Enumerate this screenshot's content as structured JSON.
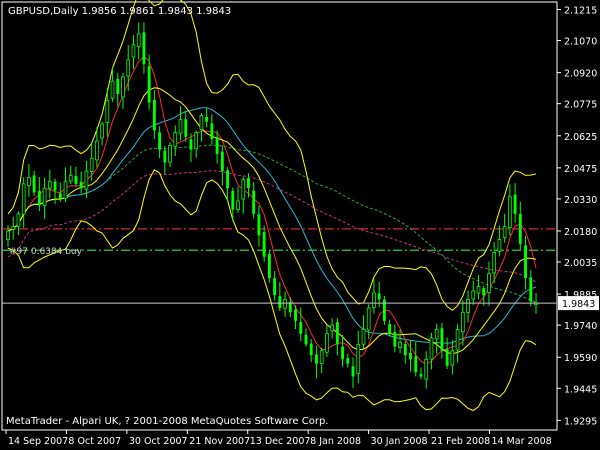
{
  "header": {
    "symbol_line": "GBPUSD,Daily  1.9856 1.9861 1.9843 1.9843"
  },
  "footer": {
    "copyright": "MetaTrader - Alpari UK, ? 2001-2008 MetaQuotes Software Corp."
  },
  "order_label": "#97 0.6384 buy",
  "colors": {
    "background": "#000000",
    "frame": "#ffffff",
    "candle": "#00ff00",
    "bollinger": "#ffff00",
    "ma_red": "#ff2a2a",
    "ma_cyan": "#27b7d8",
    "ma_green_dashed": "#2fa82f",
    "ma_magenta_dashed": "#c0367f",
    "level_red": "#d42a2a",
    "level_green": "#2fd02f",
    "bid_line": "#c8c8c8"
  },
  "chart_data": {
    "type": "candlestick",
    "title": "GBPUSD,Daily",
    "ohlc_header": [
      1.9856,
      1.9861,
      1.9843,
      1.9843
    ],
    "current_price": 1.9843,
    "current_price_label": "1.9843",
    "ylim": [
      1.925,
      2.125
    ],
    "y_ticks": [
      "2.1215",
      "2.1070",
      "2.0920",
      "2.0775",
      "2.0625",
      "2.0475",
      "2.0330",
      "2.0180",
      "2.0035",
      "1.9885",
      "1.9740",
      "1.9590",
      "1.9445",
      "1.9295"
    ],
    "x_ticks": [
      "14 Sep 2007",
      "8 Oct 2007",
      "30 Oct 2007",
      "21 Nov 2007",
      "13 Dec 2007",
      "8 Jan 2008",
      "30 Jan 2008",
      "21 Feb 2008",
      "14 Mar 2008"
    ],
    "levels": [
      {
        "name": "red-dashdot",
        "price": 2.019
      },
      {
        "name": "green-dashdot",
        "price": 2.009
      }
    ],
    "closes": [
      2.018,
      2.02,
      2.026,
      2.04,
      2.043,
      2.036,
      2.03,
      2.038,
      2.041,
      2.037,
      2.033,
      2.041,
      2.044,
      2.04,
      2.038,
      2.046,
      2.052,
      2.06,
      2.068,
      2.079,
      2.088,
      2.082,
      2.09,
      2.098,
      2.105,
      2.11,
      2.096,
      2.078,
      2.065,
      2.056,
      2.05,
      2.058,
      2.064,
      2.07,
      2.062,
      2.056,
      2.064,
      2.072,
      2.069,
      2.061,
      2.054,
      2.046,
      2.038,
      2.028,
      2.032,
      2.042,
      2.038,
      2.026,
      2.016,
      2.006,
      1.996,
      1.988,
      1.982,
      1.986,
      1.98,
      1.976,
      1.97,
      1.965,
      1.96,
      1.956,
      1.962,
      1.97,
      1.974,
      1.965,
      1.958,
      1.956,
      1.95,
      1.965,
      1.972,
      1.982,
      1.989,
      1.986,
      1.976,
      1.97,
      1.964,
      1.966,
      1.96,
      1.958,
      1.952,
      1.95,
      1.958,
      1.968,
      1.972,
      1.962,
      1.955,
      1.962,
      1.972,
      1.98,
      1.986,
      1.99,
      1.992,
      1.988,
      1.998,
      2.008,
      2.014,
      2.02,
      2.034,
      2.026,
      2.012,
      1.996,
      1.985,
      1.9843
    ]
  }
}
